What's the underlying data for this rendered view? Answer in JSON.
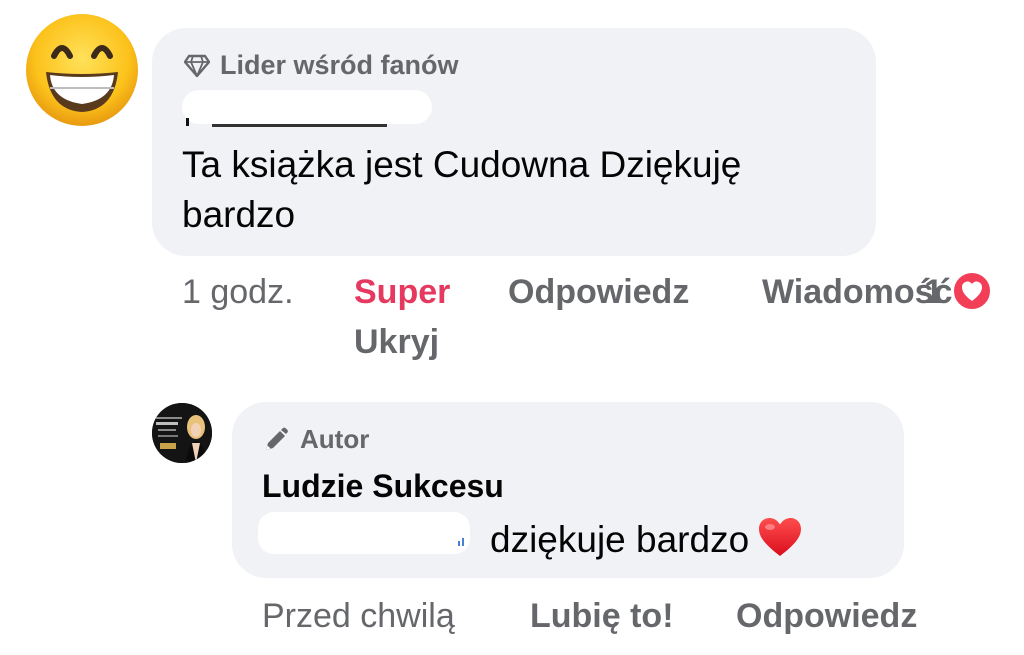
{
  "comment1": {
    "avatar_icon": "grinning-face-emoji-icon",
    "badge_icon": "diamond-icon",
    "badge_label": "Lider wśród fanów",
    "text": "Ta książka jest Cudowna Dziękuję bardzo",
    "time": "1 godz.",
    "reaction_label": "Super",
    "hide_label": "Ukryj",
    "reply_label": "Odpowiedz",
    "message_label": "Wiadomość",
    "reaction_count": "1",
    "reaction_icon": "love-heart-reaction-icon",
    "reaction_color": "#f33e58"
  },
  "comment2": {
    "avatar_icon": "profile-photo",
    "badge_icon": "pencil-icon",
    "badge_label": "Autor",
    "author_name": "Ludzie Sukcesu",
    "text": "dziękuje bardzo",
    "text_emoji": "red-heart-emoji-icon",
    "time": "Przed chwilą",
    "like_label": "Lubię to!",
    "reply_label": "Odpowiedz"
  },
  "colors": {
    "bubble": "#f0f2f5",
    "secondary_text": "#65676b",
    "super_accent": "#e5395f"
  }
}
